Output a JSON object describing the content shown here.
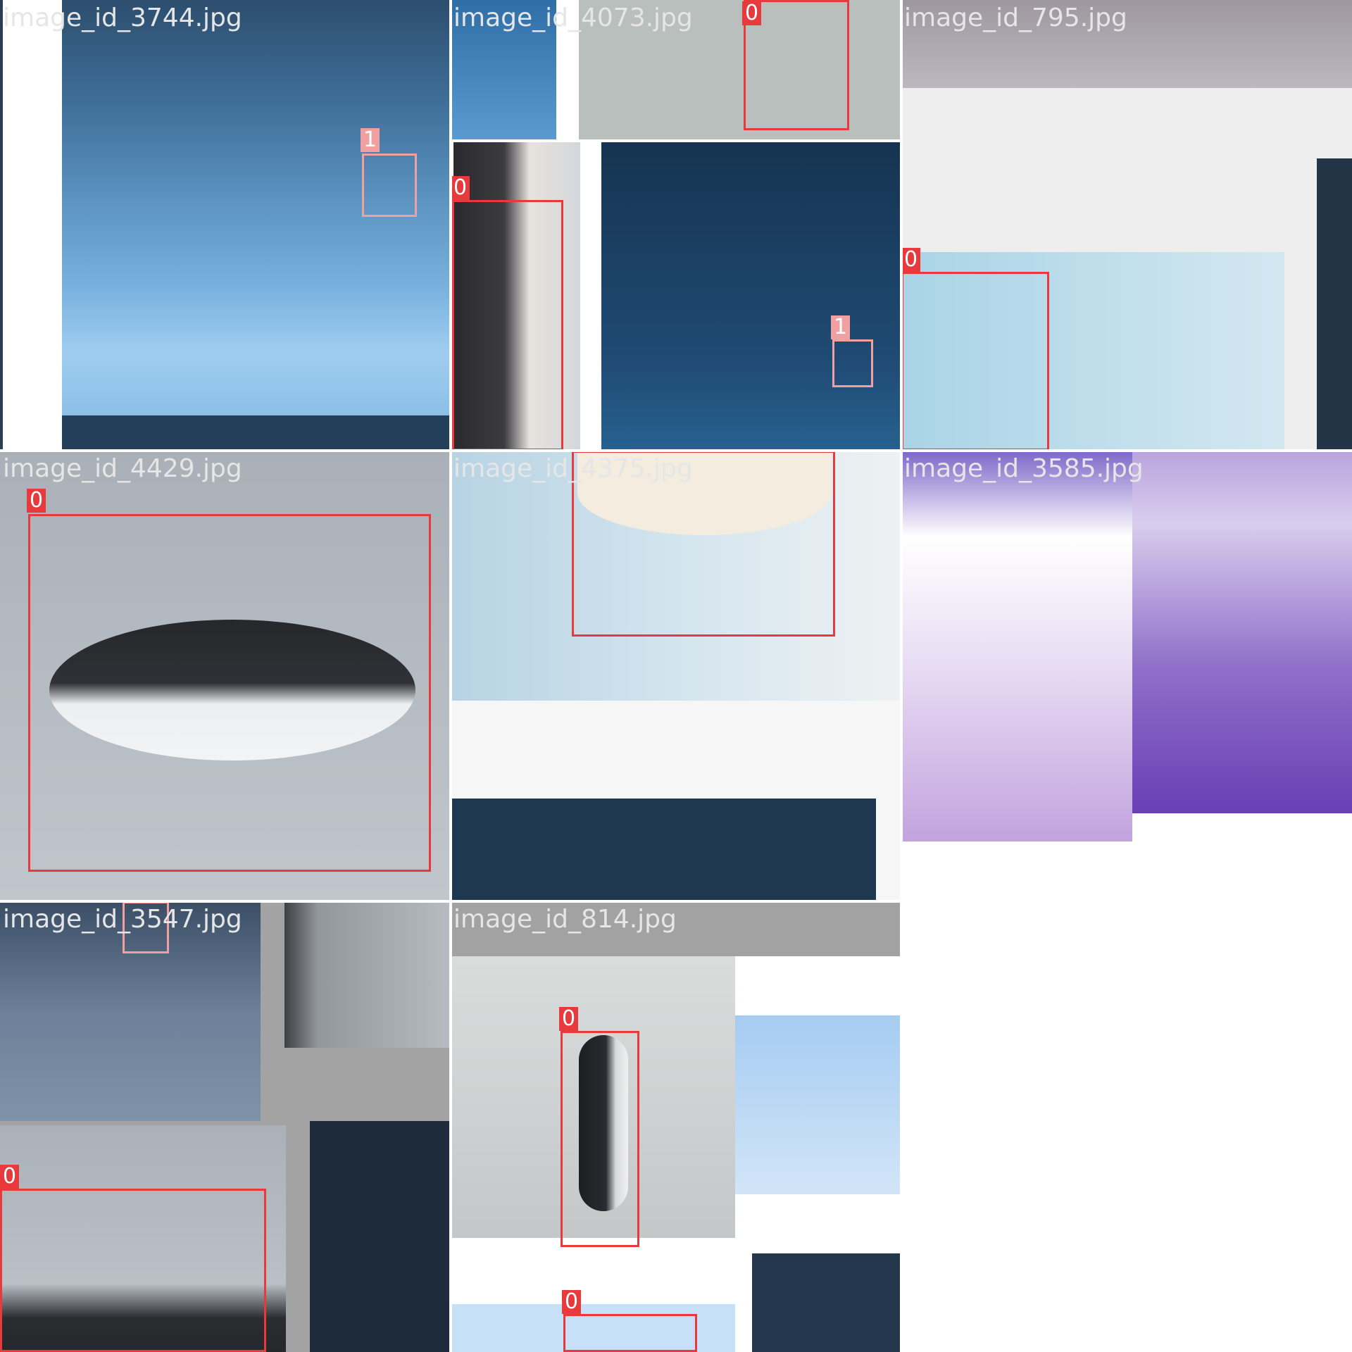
{
  "title": "",
  "palette": {
    "box_class_0": "#e8393d",
    "box_class_1": "#f0a0a0",
    "caption": "#e6e6e6"
  },
  "tiles": [
    {
      "caption": "image_id_3744.jpg",
      "labels": [
        "1"
      ]
    },
    {
      "caption": "image_id_4073.jpg",
      "labels": [
        "0",
        "0",
        "1"
      ]
    },
    {
      "caption": "image_id_795.jpg",
      "labels": [
        "0"
      ]
    },
    {
      "caption": "image_id_4429.jpg",
      "labels": [
        "0"
      ]
    },
    {
      "caption": "image_id_4375.jpg",
      "labels": [
        "0"
      ]
    },
    {
      "caption": "image_id_3585.jpg",
      "labels": []
    },
    {
      "caption": "image_id_3547.jpg",
      "labels": [
        "1",
        "0"
      ]
    },
    {
      "caption": "image_id_814.jpg",
      "labels": [
        "0",
        "0"
      ]
    }
  ]
}
